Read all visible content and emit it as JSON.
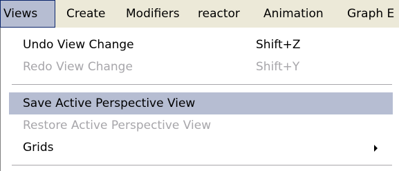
{
  "menubar": {
    "items": [
      {
        "label": "Views"
      },
      {
        "label": "Create"
      },
      {
        "label": "Modifiers"
      },
      {
        "label": "reactor"
      },
      {
        "label": "Animation"
      },
      {
        "label": "Graph E"
      }
    ]
  },
  "views_menu": {
    "items": [
      {
        "label": "Undo View Change",
        "shortcut": "Shift+Z",
        "enabled": true
      },
      {
        "label": "Redo View Change",
        "shortcut": "Shift+Y",
        "enabled": false
      },
      {
        "label": "Save Active Perspective View",
        "enabled": true,
        "highlighted": true
      },
      {
        "label": "Restore Active Perspective View",
        "enabled": false
      },
      {
        "label": "Grids",
        "enabled": true,
        "submenu": true,
        "icon": "submenu-arrow-icon"
      }
    ]
  }
}
